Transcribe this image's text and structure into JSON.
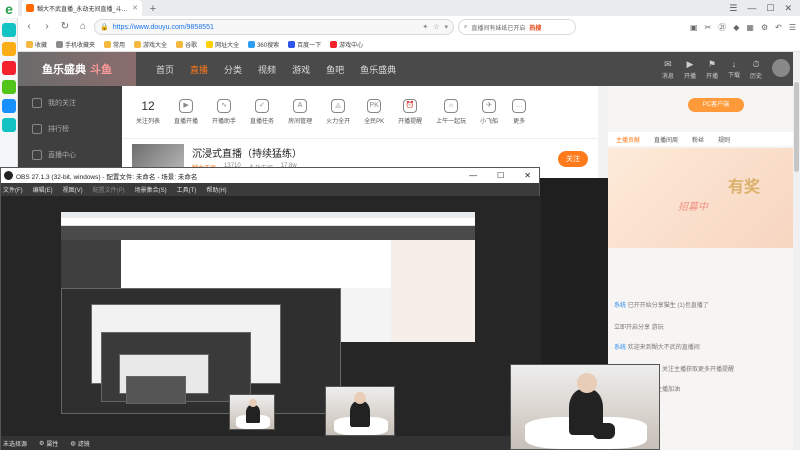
{
  "browser": {
    "tab_title": "糊大不武直播_永劫无间直播_斗…",
    "url": "https://www.douyu.com/9858551",
    "search_placeholder": "直播间有妹纸已开启",
    "search_hot": "热搜",
    "bookmarks": [
      "收藏",
      "手机收藏夹",
      "常用",
      "游戏大全",
      "谷歌",
      "网址大全",
      "360搜索",
      "百度一下",
      "游戏中心"
    ]
  },
  "douyu": {
    "logo_text": "鱼乐盛典",
    "logo_badge": "斗鱼",
    "nav": [
      "首页",
      "直播",
      "分类",
      "视频",
      "游戏",
      "鱼吧",
      "鱼乐盛典"
    ],
    "nav_active_index": 1,
    "header_icons": [
      "消息",
      "开播",
      "开播",
      "下载",
      "历史"
    ],
    "sidebar": [
      "我的关注",
      "排行榜",
      "直播中心"
    ],
    "categories": [
      {
        "label": "12",
        "sub": "关注列表"
      },
      {
        "label": "直播开播",
        "sub": "直播开播"
      },
      {
        "label": "",
        "sub": "开播助手"
      },
      {
        "label": "",
        "sub": "直播任务"
      },
      {
        "label": "",
        "sub": "房间管理"
      },
      {
        "label": "",
        "sub": "火力全开"
      },
      {
        "label": "",
        "sub": "全民PK"
      },
      {
        "label": "",
        "sub": "开播提醒"
      },
      {
        "label": "",
        "sub": "上午一起玩"
      },
      {
        "label": "",
        "sub": "小飞船"
      },
      {
        "label": "",
        "sub": "更多"
      }
    ],
    "room": {
      "title": "沉浸式直播（持续猛练）",
      "host": "糊大不武",
      "id": "13710",
      "category": "永劫无间",
      "heat": "17.8w",
      "follow": "关注"
    },
    "right_panel": {
      "ad": "PC客户端",
      "tabs": [
        "主播贡献",
        "直播间周",
        "粉丝",
        "规则"
      ],
      "banner_main": "有奖",
      "banner_sub": "招募中",
      "chat": [
        {
          "user": "系统",
          "text": "已开开始分享猫生 (1)也直播了"
        },
        {
          "user": "",
          "text": "立即开启分享 游玩"
        },
        {
          "user": "系统",
          "text": "欢迎来到糊大不武的直播间"
        },
        {
          "user": "",
          "text": "欢迎进入直播间，关注主播获取更多开播提醒"
        },
        {
          "user": "",
          "text": "支付鱼翅可以给主播加油"
        }
      ]
    }
  },
  "obs": {
    "title": "OBS 27.1.3 (32-bit, windows) - 配置文件: 未命名 - 场景: 未命名",
    "menu": [
      "文件(F)",
      "编辑(E)",
      "视图(V)",
      "配置文件(P)",
      "场景集合(S)",
      "工具(T)",
      "帮助(H)"
    ],
    "status": [
      "未选择源",
      "属性",
      "滤镜"
    ]
  }
}
